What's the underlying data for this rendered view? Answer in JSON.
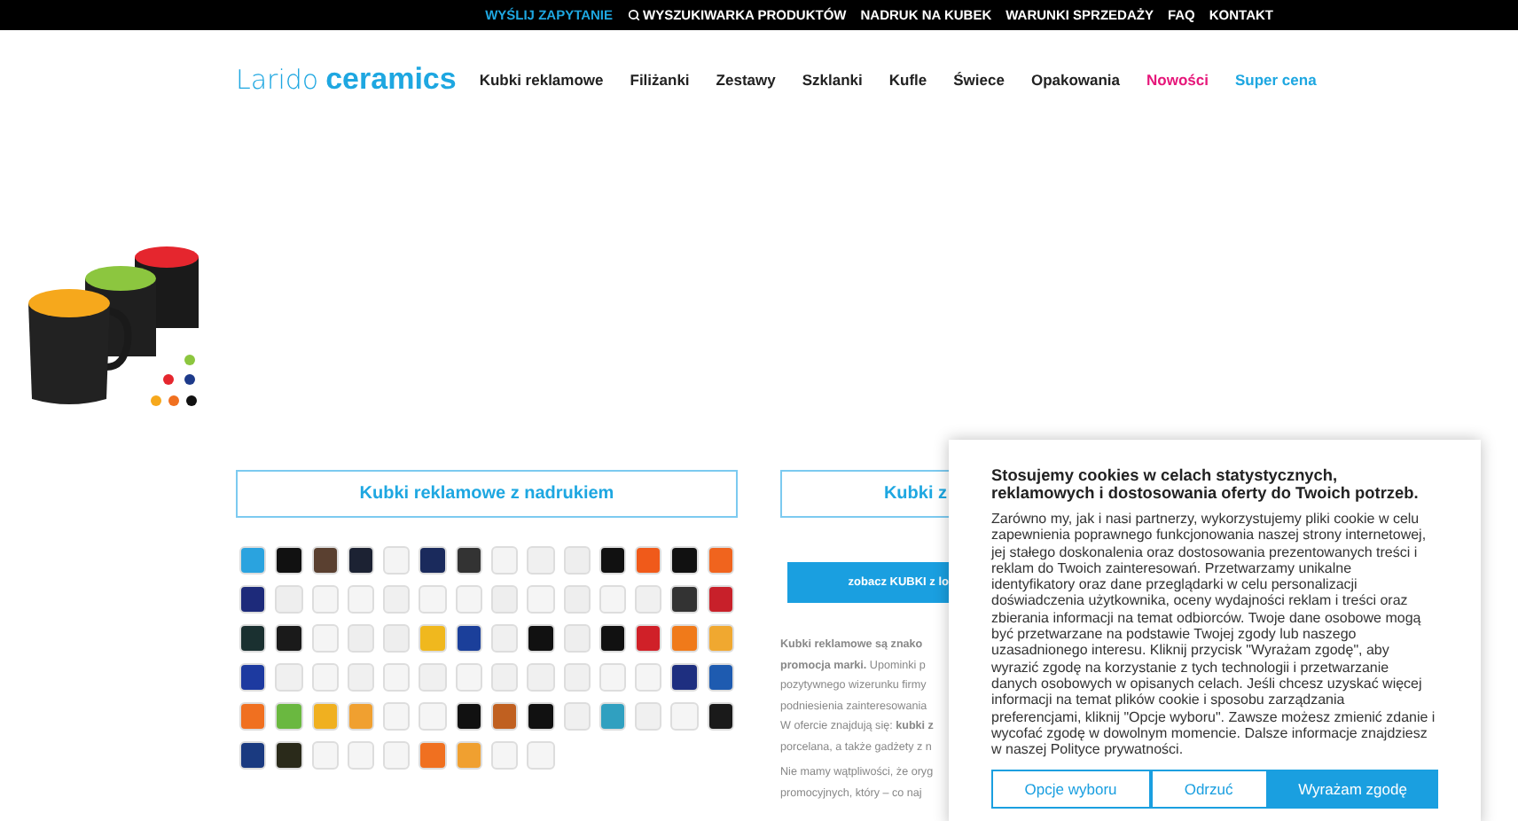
{
  "top_bar": {
    "links": [
      {
        "label": "WYŚLIJ ZAPYTANIE",
        "kind": "highlight"
      },
      {
        "label": "WYSZUKIWARKA PRODUKTÓW",
        "kind": "search"
      },
      {
        "label": "NADRUK NA KUBEK",
        "kind": "plain"
      },
      {
        "label": "WARUNKI SPRZEDAŻY",
        "kind": "plain"
      },
      {
        "label": "FAQ",
        "kind": "plain"
      },
      {
        "label": "KONTAKT",
        "kind": "plain"
      }
    ]
  },
  "header": {
    "logo": {
      "light": "Larido",
      "bold": "ceramics"
    },
    "nav": [
      {
        "label": "Kubki reklamowe",
        "kind": "plain"
      },
      {
        "label": "Filiżanki",
        "kind": "plain"
      },
      {
        "label": "Zestawy",
        "kind": "plain"
      },
      {
        "label": "Szklanki",
        "kind": "plain"
      },
      {
        "label": "Kufle",
        "kind": "plain"
      },
      {
        "label": "Świece",
        "kind": "plain"
      },
      {
        "label": "Opakowania",
        "kind": "plain"
      },
      {
        "label": "Nowości",
        "kind": "new"
      },
      {
        "label": "Super cena",
        "kind": "promo"
      }
    ]
  },
  "left_column": {
    "heading": "Kubki reklamowe z nadrukiem"
  },
  "right_column": {
    "heading": "Kubki z",
    "button": "zobacz KUBKI z lo",
    "paragraphs": [
      [
        "**Kubki reklamowe są znako**",
        "**promocja marki.** Upominki p",
        "pozytywnego wizerunku firmy",
        "podniesienia zainteresowania",
        "W ofercie znajdują się: **kubki z**",
        "porcelana, a także gadżety z n"
      ],
      [
        "Nie mamy wątpliwości, że oryg",
        "promocyjnych, który – co naj"
      ]
    ]
  },
  "cookie_dialog": {
    "title": "Stosujemy cookies w celach statystycznych, reklamowych i dostosowania oferty do Twoich potrzeb.",
    "body": "Zarówno my, jak i nasi partnerzy, wykorzystujemy pliki cookie w celu zapewnienia poprawnego funkcjonowania naszej strony internetowej, jej stałego doskonalenia oraz dostosowania prezentowanych treści i reklam do Twoich zainteresowań. Przetwarzamy unikalne identyfikatory oraz dane przeglądarki w celu personalizacji doświadczenia użytkownika, oceny wydajności reklam i treści oraz zbierania informacji na temat odbiorców. Twoje dane osobowe mogą być przetwarzane na podstawie Twojej zgody lub naszego uzasadnionego interesu. Kliknij przycisk \"Wyrażam zgodę\", aby wyrazić zgodę na korzystanie z tych technologii i przetwarzanie danych osobowych w opisanych celach. Jeśli chcesz uzyskać więcej informacji na temat plików cookie i sposobu zarządzania preferencjami, kliknij \"Opcje wyboru\". Zawsze możesz zmienić zdanie i wycofać zgodę w dowolnym momencie. Dalsze informacje znajdziesz w naszej Polityce prywatności.",
    "buttons": [
      {
        "label": "Opcje wyboru",
        "kind": "outline"
      },
      {
        "label": "Odrzuć",
        "kind": "outline"
      },
      {
        "label": "Wyrażam zgodę",
        "kind": "primary"
      }
    ]
  }
}
